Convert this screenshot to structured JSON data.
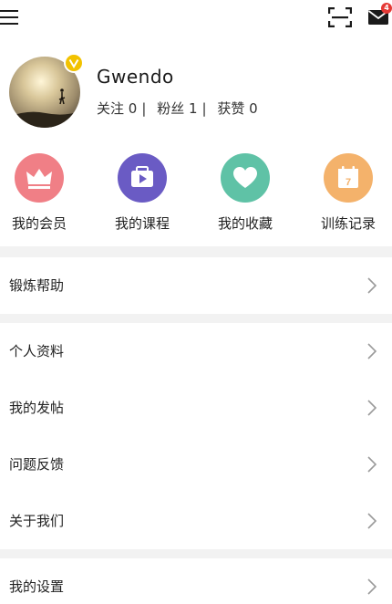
{
  "topbar": {
    "menu_icon": "hamburger-menu-icon",
    "scan_icon": "scan-icon",
    "mail_icon": "mail-icon",
    "mail_badge": "4"
  },
  "profile": {
    "username": "Gwendo",
    "follow_label": "关注",
    "follow_count": "0",
    "fans_label": "粉丝",
    "fans_count": "1",
    "likes_label": "获赞",
    "likes_count": "0",
    "separator": "|"
  },
  "quick_actions": [
    {
      "label": "我的会员",
      "icon": "crown-icon",
      "color": "#f07f86"
    },
    {
      "label": "我的课程",
      "icon": "course-play-icon",
      "color": "#6a5bc4"
    },
    {
      "label": "我的收藏",
      "icon": "heart-icon",
      "color": "#5fc2a6"
    },
    {
      "label": "训练记录",
      "icon": "calendar-icon",
      "color": "#f4b26b",
      "calendar_day": "7"
    }
  ],
  "menu": {
    "exercise_help": "锻炼帮助",
    "personal_info": "个人资料",
    "my_posts": "我的发帖",
    "feedback": "问题反馈",
    "about_us": "关于我们",
    "settings": "我的设置"
  },
  "colors": {
    "gap": "#f2f2f2",
    "vip_badge": "#f2c200",
    "badge_red": "#e53935"
  }
}
